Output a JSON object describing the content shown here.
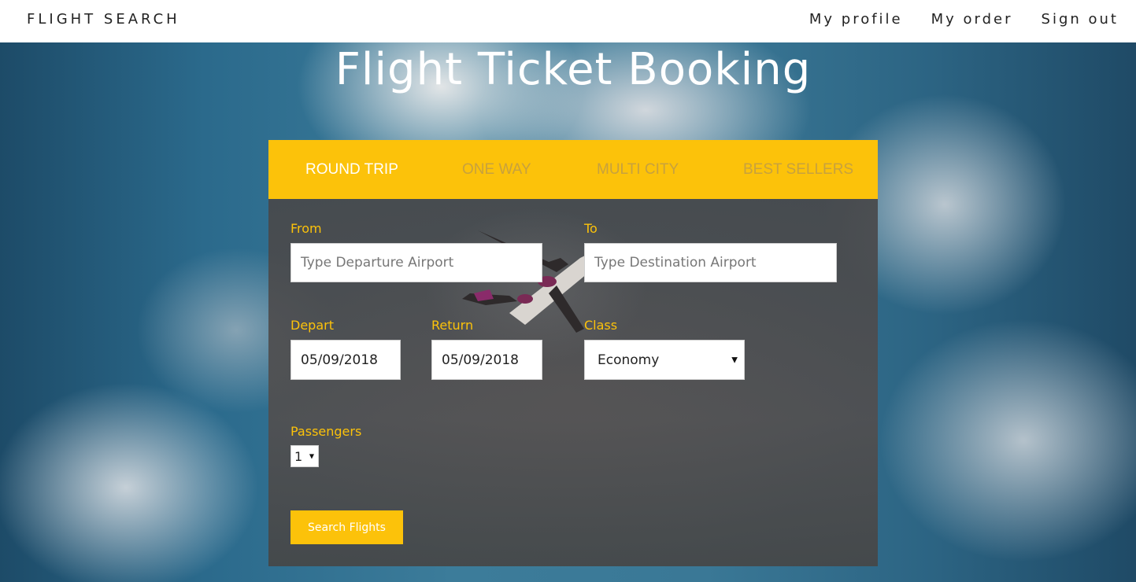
{
  "nav": {
    "brand": "FLIGHT SEARCH",
    "links": [
      "My profile",
      "My order",
      "Sign out"
    ]
  },
  "hero": {
    "title": "Flight Ticket Booking"
  },
  "tabs": [
    {
      "label": "ROUND TRIP",
      "active": true
    },
    {
      "label": "ONE WAY",
      "active": false
    },
    {
      "label": "MULTI CITY",
      "active": false
    },
    {
      "label": "BEST SELLERS",
      "active": false
    }
  ],
  "form": {
    "from_label": "From",
    "from_placeholder": "Type Departure Airport",
    "to_label": "To",
    "to_placeholder": "Type Destination Airport",
    "depart_label": "Depart",
    "depart_value": "05/09/2018",
    "return_label": "Return",
    "return_value": "05/09/2018",
    "class_label": "Class",
    "class_value": "Economy",
    "passengers_label": "Passengers",
    "passengers_value": "1",
    "search_label": "Search Flights"
  },
  "colors": {
    "accent": "#fcc20a",
    "panel": "#4a4a4c"
  },
  "icons": {
    "select_arrow": "caret-down-icon"
  }
}
